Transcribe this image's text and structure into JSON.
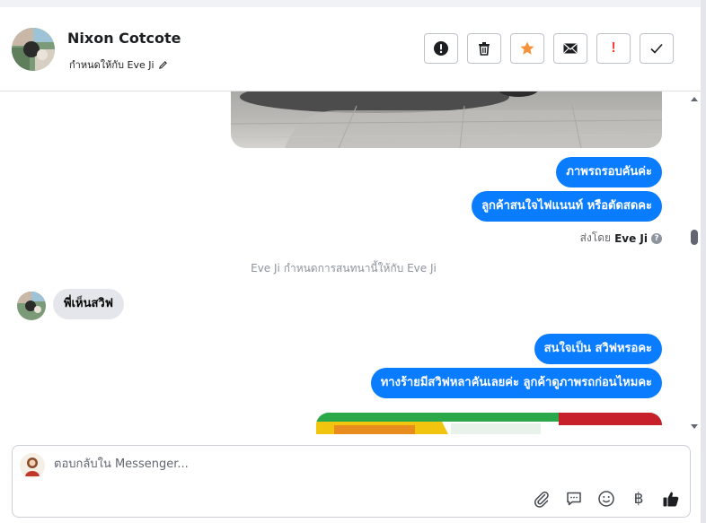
{
  "header": {
    "contact_name": "Nixon Cotcote",
    "assigned_label": "กำหนดให้กับ Eve Ji"
  },
  "icons": {
    "alert": "exclamation-circle-icon",
    "trash": "trash-icon",
    "star": "star-icon",
    "mail": "envelope-icon",
    "spam": "exclamation-icon",
    "done": "check-icon",
    "attach": "paperclip-icon",
    "saved_reply": "chat-bubble-icon",
    "emoji": "smile-icon",
    "payment": "baht-icon",
    "like": "thumbs-up-icon"
  },
  "actions": {
    "spam_symbol": "!"
  },
  "messages": {
    "out_1": "ภาพรถรอบคันค่ะ",
    "out_2": "ลูกค้าสนใจไฟแนนท์ หรือตัดสดคะ",
    "sent_by_prefix": "ส่งโดย",
    "sent_by_name": "Eve Ji",
    "help_symbol": "?",
    "system_note": "Eve Ji กำหนดการสนทนานี้ให้กับ Eve Ji",
    "in_1": "พี่เห็นสวิฟ",
    "out_3": "สนใจเป็น สวิฟหรอคะ",
    "out_4": "ทางร้ายมีสวิฟหลาคันเลยค่ะ ลูกค้าดูภาพรถก่อนไหมคะ"
  },
  "composer": {
    "placeholder": "ตอบกลับใน Messenger...",
    "baht_symbol": "฿"
  },
  "colors": {
    "outgoing_bubble": "#0a7cff",
    "incoming_bubble": "#e4e6eb",
    "star": "#f7923a",
    "spam": "#fa3e3e"
  }
}
